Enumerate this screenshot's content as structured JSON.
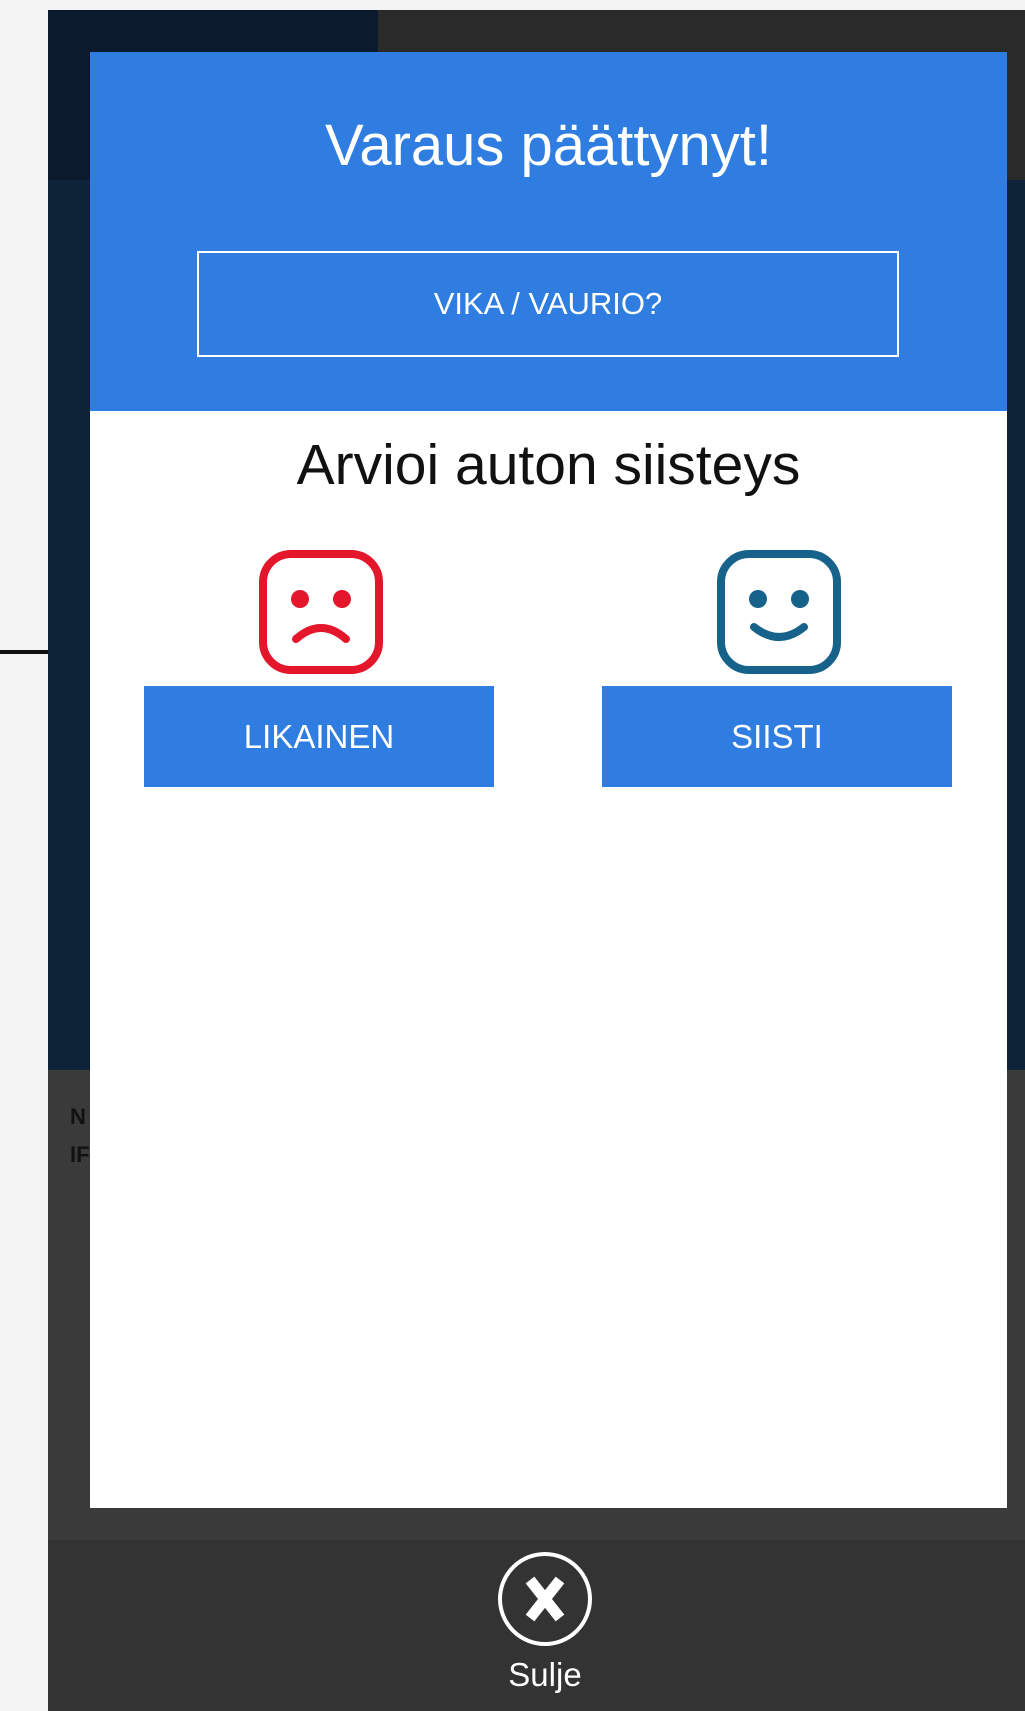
{
  "modal": {
    "title": "Varaus päättynyt!",
    "report_button_label": "VIKA / VAURIO?",
    "rating_heading": "Arvioi auton siisteys",
    "options": [
      {
        "label": "LIKAINEN",
        "icon": "sad-face-icon",
        "icon_color": "#e3162b"
      },
      {
        "label": "SIISTI",
        "icon": "happy-face-icon",
        "icon_color": "#17628a"
      }
    ]
  },
  "close": {
    "label": "Sulje",
    "icon": "close-x-icon"
  },
  "background": {
    "info_lines": [
      "N",
      "IF"
    ]
  },
  "colors": {
    "accent": "#2f7de1",
    "overlay": "#333333"
  }
}
